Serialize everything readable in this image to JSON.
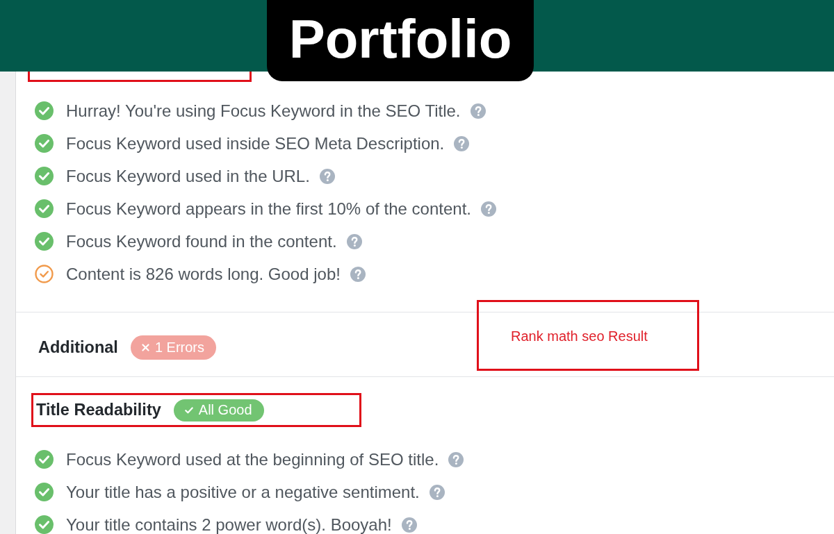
{
  "banner": {
    "title": "Portfolio"
  },
  "sections": [
    {
      "highlighted": true,
      "checks": [
        {
          "kind": "pass",
          "text": "Hurray! You're using Focus Keyword in the SEO Title."
        },
        {
          "kind": "pass",
          "text": "Focus Keyword used inside SEO Meta Description."
        },
        {
          "kind": "pass",
          "text": "Focus Keyword used in the URL."
        },
        {
          "kind": "pass",
          "text": "Focus Keyword appears in the first 10% of the content."
        },
        {
          "kind": "pass",
          "text": "Focus Keyword found in the content."
        },
        {
          "kind": "warning",
          "text": "Content is 826 words long. Good job!"
        }
      ]
    },
    {
      "title": "Additional",
      "highlighted": false,
      "badge": {
        "kind": "error",
        "label": "1 Errors"
      },
      "callout": {
        "label": "Rank math seo Result"
      }
    },
    {
      "title": "Title Readability",
      "highlighted": true,
      "badge": {
        "kind": "good",
        "label": "All Good"
      },
      "checks": [
        {
          "kind": "pass",
          "text": "Focus Keyword used at the beginning of SEO title."
        },
        {
          "kind": "pass",
          "text": "Your title has a positive or a negative sentiment."
        },
        {
          "kind": "pass",
          "text": "Your title contains 2 power word(s). Booyah!"
        }
      ]
    }
  ]
}
